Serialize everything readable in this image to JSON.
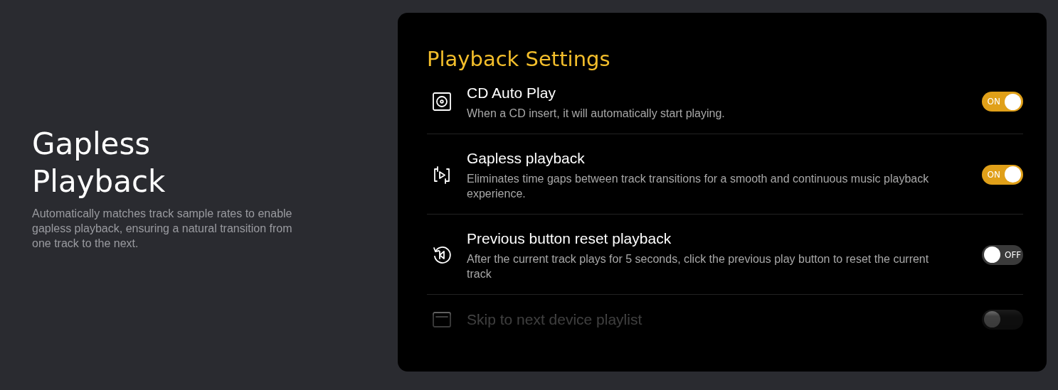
{
  "intro": {
    "title": "Gapless Playback",
    "description": "Automatically matches track sample rates to enable gapless playback, ensuring a natural transition from one track to the next."
  },
  "panel": {
    "title": "Playback Settings",
    "settings": [
      {
        "kind": "disc",
        "title": "CD Auto Play",
        "description": "When a CD insert, it will automatically start playing.",
        "on": true,
        "toggle_label": "ON"
      },
      {
        "kind": "repeat",
        "title": "Gapless playback",
        "description": "Eliminates time gaps between track transitions for a smooth and continuous music playback experience.",
        "on": true,
        "toggle_label": "ON"
      },
      {
        "kind": "restart",
        "title": "Previous button reset playback",
        "description": "After the current track plays for 5 seconds, click the previous play button to reset the current track",
        "on": false,
        "toggle_label": "OFF"
      },
      {
        "kind": "list",
        "title": "Skip to next device playlist",
        "on": false
      }
    ]
  }
}
